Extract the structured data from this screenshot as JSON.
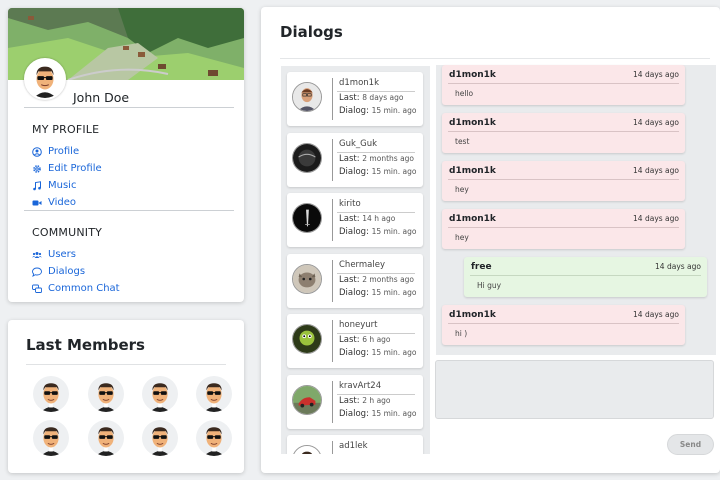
{
  "profile": {
    "user_name": "John Doe",
    "my_profile_title": "MY PROFILE",
    "my_profile_links": [
      {
        "label": "Profile",
        "icon": "user-circle-icon"
      },
      {
        "label": "Edit Profile",
        "icon": "gear-icon"
      },
      {
        "label": "Music",
        "icon": "music-note-icon"
      },
      {
        "label": "Video",
        "icon": "video-camera-icon"
      }
    ],
    "community_title": "COMMUNITY",
    "community_links": [
      {
        "label": "Users",
        "icon": "users-icon"
      },
      {
        "label": "Dialogs",
        "icon": "speech-bubble-icon"
      },
      {
        "label": "Common Chat",
        "icon": "chat-bubbles-icon"
      }
    ]
  },
  "last_members": {
    "title": "Last Members",
    "count": 8
  },
  "dialogs": {
    "title": "Dialogs",
    "last_prefix": "Last:",
    "dialog_prefix": "Dialog:",
    "items": [
      {
        "name": "d1mon1k",
        "last": "8 days ago",
        "duration": "15 min. ago",
        "avatar": "avatar-portrait"
      },
      {
        "name": "Guk_Guk",
        "last": "2 months ago",
        "duration": "15 min. ago",
        "avatar": "avatar-dark"
      },
      {
        "name": "kirito",
        "last": "14 h ago",
        "duration": "15 min. ago",
        "avatar": "avatar-black"
      },
      {
        "name": "Chermaley",
        "last": "2 months ago",
        "duration": "15 min. ago",
        "avatar": "avatar-cat"
      },
      {
        "name": "honeyurt",
        "last": "6 h ago",
        "duration": "15 min. ago",
        "avatar": "avatar-green"
      },
      {
        "name": "kravArt24",
        "last": "2 h ago",
        "duration": "15 min. ago",
        "avatar": "avatar-car"
      },
      {
        "name": "ad1lek",
        "last": "",
        "duration": "",
        "avatar": "avatar-cartoon"
      }
    ],
    "messages": [
      {
        "author": "d1mon1k",
        "time": "14 days ago",
        "text": "hello",
        "direction": "in"
      },
      {
        "author": "d1mon1k",
        "time": "14 days ago",
        "text": "test",
        "direction": "in"
      },
      {
        "author": "d1mon1k",
        "time": "14 days ago",
        "text": "hey",
        "direction": "in"
      },
      {
        "author": "d1mon1k",
        "time": "14 days ago",
        "text": "hey",
        "direction": "in"
      },
      {
        "author": "free",
        "time": "14 days ago",
        "text": "Hi guy",
        "direction": "out"
      },
      {
        "author": "d1mon1k",
        "time": "14 days ago",
        "text": "hi )",
        "direction": "in"
      }
    ],
    "input_value": "",
    "send_label": "Send"
  },
  "colors": {
    "link": "#1a66d9",
    "incoming_bg": "#fbe7e9",
    "outgoing_bg": "#e6f6e2",
    "page_bg": "#eef0f2"
  }
}
